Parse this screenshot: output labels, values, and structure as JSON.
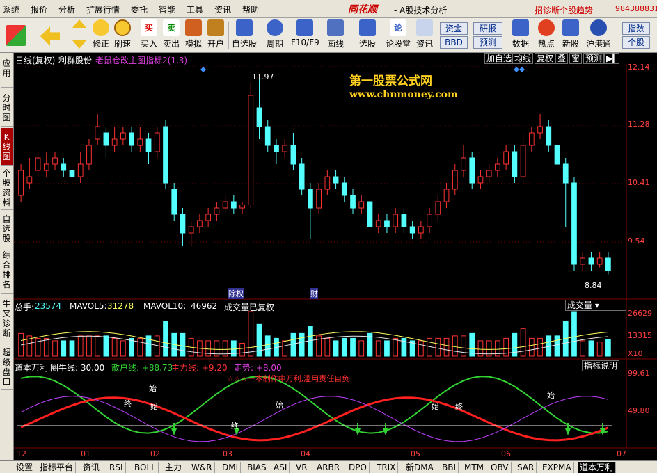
{
  "menu": {
    "items": [
      "系统",
      "报价",
      "分析",
      "扩展行情",
      "委托",
      "智能",
      "工具",
      "资讯",
      "帮助"
    ],
    "brand": "同花顺",
    "app_title": "- A股技术分析",
    "slogan": "一招诊断个股趋势",
    "phone": "984388831"
  },
  "toolbar": {
    "buttons": [
      "修正",
      "刷速",
      "买入",
      "卖出",
      "模拟",
      "开户",
      "自选股",
      "周期",
      "F10/F9",
      "画线",
      "选股",
      "论股堂",
      "资讯",
      "数据",
      "热点",
      "新股",
      "沪港通"
    ],
    "boxes": [
      "资金",
      "研报",
      "BBD",
      "预测",
      "指数",
      "个股"
    ]
  },
  "sidebar": {
    "items": [
      "应用",
      "分时图",
      "K线图",
      "个股资料",
      "自选股",
      "综合排名",
      "牛叉诊断",
      "超级盘口"
    ]
  },
  "chart_header": {
    "period": "日线(复权)",
    "stock": "利群股份",
    "indicator": "老鼠仓改主图指标2(1,3)",
    "buttons": [
      "加自选",
      "均线",
      "复权",
      "叠",
      "窗",
      "预测"
    ]
  },
  "watermark": {
    "line1": "第一股票公式网",
    "line2": "www.chnmoney.com"
  },
  "annotations": {
    "high_label": "11.97",
    "low_label": "8.84",
    "event1": "除权",
    "event2": "财"
  },
  "volume_header": {
    "total_label": "总手: ",
    "total_value": "23574",
    "mavol5_label": "MAVOL5: ",
    "mavol5_value": "31278",
    "mavol10_label": "MAVOL10: ",
    "mavol10_value": "46962",
    "note": "成交量已复权",
    "selector": "成交量",
    "axis_labels": [
      "26629",
      "13315",
      "X10"
    ]
  },
  "indicator_header": {
    "name": "道本万利",
    "line1": "圈牛线: 30.00",
    "line2": "散户线: +88.73",
    "line3": "主力线: +9.20",
    "line4": "走势: +8.00",
    "legend": "☆☆☆一本制作中万利,滥用责任自负",
    "button": "指标说明",
    "axis_labels": [
      "99.61",
      "49.80"
    ],
    "marks": [
      "始",
      "终",
      "始",
      "终",
      "始",
      "终",
      "始",
      "始"
    ]
  },
  "price_axis": [
    "12.14",
    "11.28",
    "10.41",
    "9.54",
    "8.84"
  ],
  "time_axis": [
    "12",
    "01",
    "02",
    "03",
    "04",
    "05",
    "06",
    "07"
  ],
  "bottom_tabs": [
    "设置",
    "指标平台",
    "资讯",
    "RSI",
    "BOLL",
    "主力",
    "W&R",
    "DMI",
    "BIAS",
    "ASI",
    "VR",
    "ARBR",
    "DPO",
    "TRIX",
    "新DMA",
    "BBI",
    "MTM",
    "OBV",
    "SAR",
    "EXPMA",
    "道本万利"
  ],
  "colors": {
    "up": "#ff3232",
    "down": "#54ffff",
    "grid": "#7a0000",
    "green_line": "#32d232",
    "red_line": "#ff2020",
    "purple_line": "#c040ff",
    "white_line": "#e8e8e8",
    "yellow_line": "#ffff60"
  },
  "chart_data": {
    "type": "candlestick",
    "price_range": [
      8.6,
      12.2
    ],
    "candles": [
      [
        10.1,
        10.5,
        10.6,
        10.0
      ],
      [
        10.3,
        10.4,
        10.7,
        10.2
      ],
      [
        10.5,
        10.7,
        10.8,
        10.4
      ],
      [
        10.5,
        10.6,
        10.8,
        10.4
      ],
      [
        10.6,
        10.7,
        10.8,
        10.5
      ],
      [
        10.6,
        10.5,
        10.7,
        10.4
      ],
      [
        10.5,
        10.4,
        10.6,
        10.3
      ],
      [
        10.4,
        10.6,
        10.8,
        10.3
      ],
      [
        10.6,
        10.9,
        11.0,
        10.5
      ],
      [
        11.0,
        11.2,
        11.4,
        10.9
      ],
      [
        11.1,
        10.9,
        11.2,
        10.7
      ],
      [
        10.9,
        11.0,
        11.2,
        10.8
      ],
      [
        11.0,
        11.1,
        11.2,
        10.9
      ],
      [
        11.1,
        10.9,
        11.2,
        10.8
      ],
      [
        10.9,
        11.0,
        11.2,
        10.8
      ],
      [
        11.0,
        10.8,
        11.1,
        10.6
      ],
      [
        10.8,
        11.1,
        11.2,
        10.7
      ],
      [
        11.2,
        10.3,
        11.3,
        10.2
      ],
      [
        10.2,
        9.8,
        10.3,
        9.7
      ],
      [
        9.8,
        9.5,
        9.9,
        9.3
      ],
      [
        9.5,
        9.6,
        9.7,
        9.3
      ],
      [
        9.6,
        9.7,
        9.8,
        9.5
      ],
      [
        9.7,
        9.8,
        9.9,
        9.6
      ],
      [
        9.8,
        9.9,
        10.0,
        9.7
      ],
      [
        9.9,
        10.0,
        10.1,
        9.8
      ],
      [
        10.0,
        9.9,
        10.1,
        9.8
      ],
      [
        9.9,
        9.95,
        10.0,
        9.8
      ],
      [
        9.95,
        11.7,
        11.9,
        9.9
      ],
      [
        11.5,
        11.2,
        11.97,
        11.0
      ],
      [
        11.2,
        10.9,
        11.3,
        10.8
      ],
      [
        10.9,
        10.8,
        11.0,
        10.6
      ],
      [
        10.8,
        10.9,
        11.0,
        10.7
      ],
      [
        10.9,
        10.6,
        11.1,
        10.5
      ],
      [
        10.6,
        10.2,
        10.7,
        10.1
      ],
      [
        10.2,
        9.9,
        10.3,
        9.4
      ],
      [
        9.9,
        10.2,
        10.3,
        9.8
      ],
      [
        10.2,
        10.4,
        10.5,
        10.1
      ],
      [
        10.4,
        10.3,
        10.5,
        10.2
      ],
      [
        10.3,
        10.1,
        10.4,
        10.0
      ],
      [
        10.1,
        9.9,
        10.2,
        9.8
      ],
      [
        9.9,
        10.0,
        10.1,
        9.8
      ],
      [
        10.0,
        9.6,
        10.1,
        9.5
      ],
      [
        9.6,
        9.7,
        9.8,
        9.5
      ],
      [
        9.7,
        9.6,
        9.8,
        9.5
      ],
      [
        9.6,
        9.8,
        9.9,
        9.5
      ],
      [
        9.8,
        9.6,
        9.9,
        9.5
      ],
      [
        9.6,
        9.5,
        9.7,
        9.4
      ],
      [
        9.5,
        9.6,
        9.7,
        9.4
      ],
      [
        9.6,
        9.8,
        9.9,
        9.5
      ],
      [
        9.8,
        10.0,
        10.1,
        9.7
      ],
      [
        10.0,
        10.2,
        10.3,
        9.9
      ],
      [
        10.2,
        10.5,
        10.6,
        10.1
      ],
      [
        10.5,
        10.7,
        10.9,
        10.4
      ],
      [
        10.7,
        10.3,
        10.8,
        10.2
      ],
      [
        10.3,
        10.4,
        10.5,
        10.2
      ],
      [
        10.4,
        10.5,
        10.6,
        10.3
      ],
      [
        10.5,
        10.6,
        10.7,
        10.4
      ],
      [
        10.6,
        10.8,
        10.9,
        10.5
      ],
      [
        10.8,
        10.4,
        10.9,
        10.3
      ],
      [
        10.4,
        10.9,
        11.1,
        10.3
      ],
      [
        10.9,
        11.1,
        11.2,
        10.8
      ],
      [
        11.1,
        11.2,
        11.4,
        11.0
      ],
      [
        11.2,
        10.9,
        11.3,
        10.8
      ],
      [
        10.9,
        10.6,
        11.0,
        10.5
      ],
      [
        10.6,
        10.3,
        10.7,
        9.6
      ],
      [
        10.3,
        9.0,
        10.4,
        8.9
      ],
      [
        9.0,
        9.1,
        9.2,
        8.9
      ],
      [
        9.1,
        9.0,
        9.2,
        8.9
      ],
      [
        9.0,
        9.1,
        9.2,
        8.95
      ],
      [
        9.1,
        8.9,
        9.2,
        8.84
      ]
    ]
  }
}
